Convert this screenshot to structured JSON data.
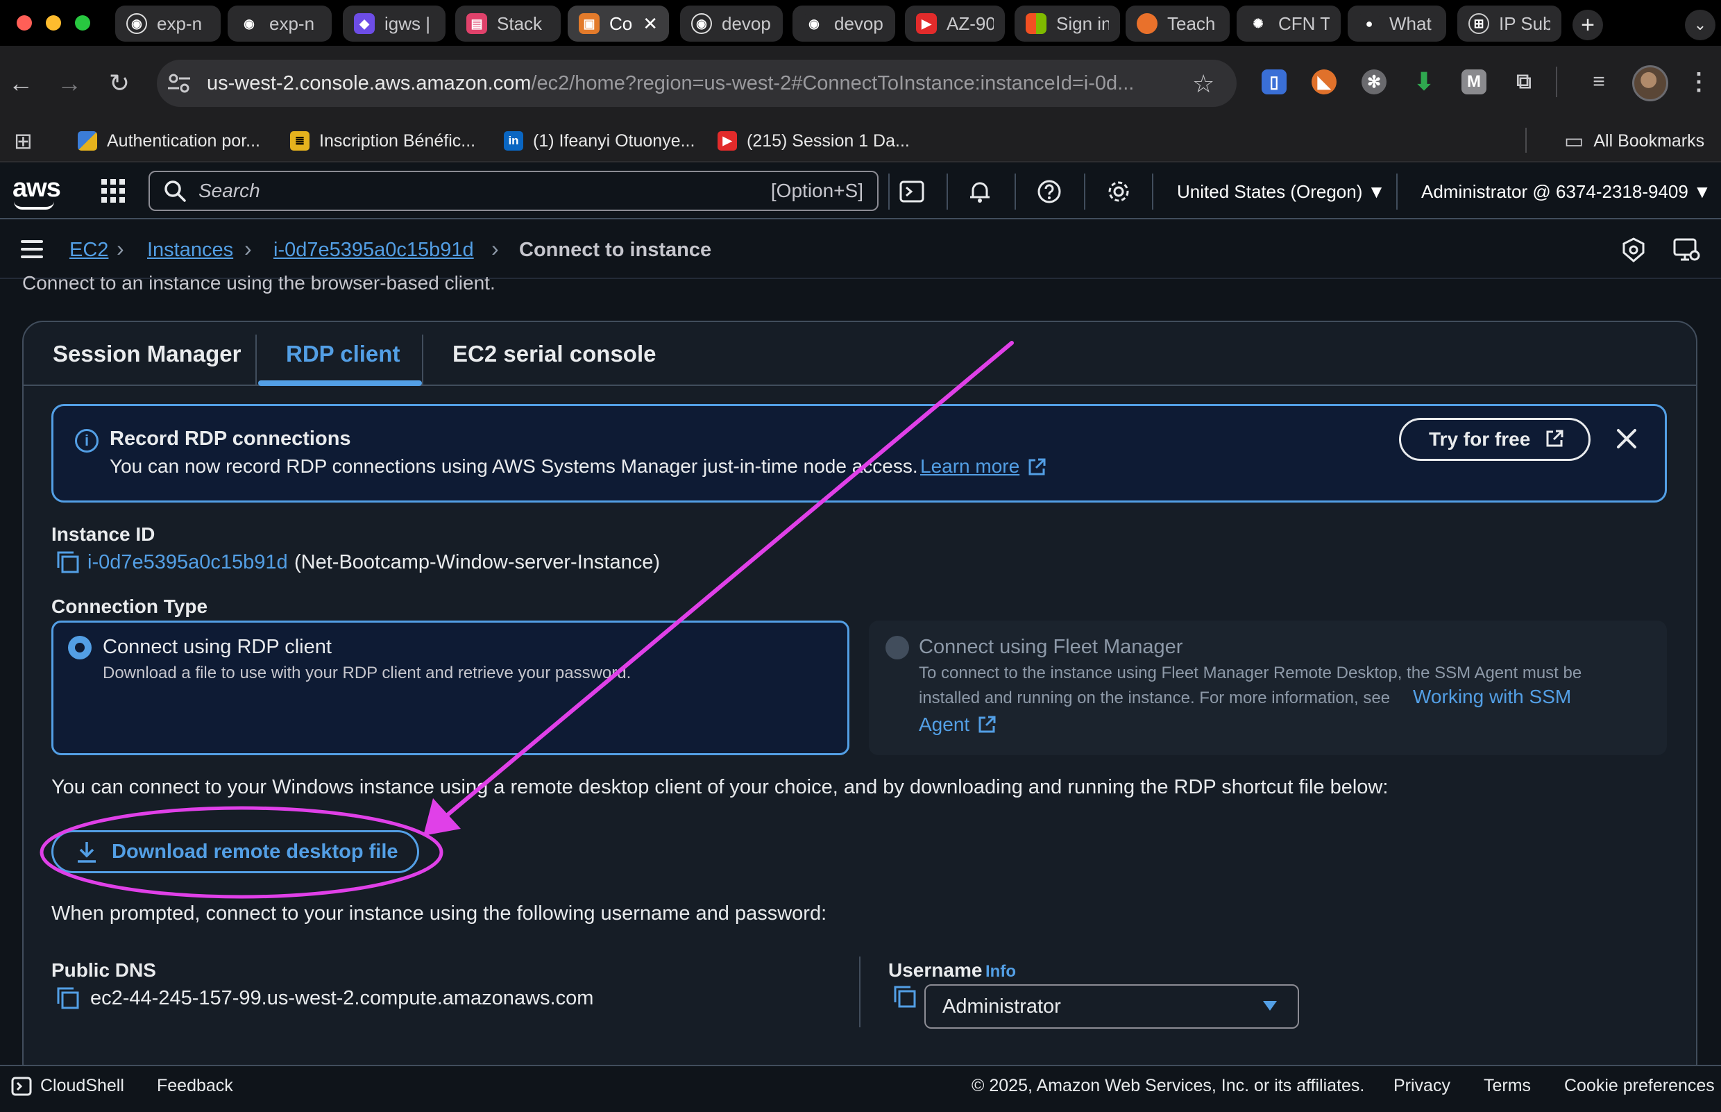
{
  "browser": {
    "tabs": [
      {
        "label": "exp-n",
        "icon": "github-icon",
        "color": "#2a2a2c"
      },
      {
        "label": "exp-n",
        "icon": "github-icon",
        "color": "#2a2a2c"
      },
      {
        "label": "igws |",
        "icon": "igws-icon",
        "color": "#6d4de6"
      },
      {
        "label": "Stack",
        "icon": "stack-icon",
        "color": "#e0426b"
      },
      {
        "label": "Co",
        "icon": "aws-console-icon",
        "color": "#e37b2b"
      },
      {
        "label": "devop",
        "icon": "github-icon",
        "color": "#2a2a2c"
      },
      {
        "label": "devop",
        "icon": "github-icon",
        "color": "#2a2a2c"
      },
      {
        "label": "AZ-90",
        "icon": "youtube-icon",
        "color": "#e22b2b"
      },
      {
        "label": "Sign in",
        "icon": "microsoft-icon",
        "color": "#2a2a2c"
      },
      {
        "label": "Teach",
        "icon": "teach-icon",
        "color": "#e9712b"
      },
      {
        "label": "CFN T",
        "icon": "openai-icon",
        "color": "#2a2a2c"
      },
      {
        "label": "What",
        "icon": "globe-icon",
        "color": "#2a2a2c"
      },
      {
        "label": "IP Sub",
        "icon": "ipsub-icon",
        "color": "#2a2a2c"
      }
    ],
    "url_host": "us-west-2.console.aws.amazon.com",
    "url_path": "/ec2/home?region=us-west-2#ConnectToInstance:instanceId=i-0d...",
    "bookmarks": [
      {
        "label": "Authentication por...",
        "icon": "flag-icon"
      },
      {
        "label": "Inscription Bénéfic...",
        "icon": "form-icon"
      },
      {
        "label": "(1) Ifeanyi Otuonye...",
        "icon": "linkedin-icon"
      },
      {
        "label": "(215) Session 1 Da...",
        "icon": "youtube-icon"
      }
    ],
    "all_bookmarks": "All Bookmarks"
  },
  "aws_header": {
    "logo": "aws",
    "search_placeholder": "Search",
    "search_shortcut": "[Option+S]",
    "region": "United States (Oregon) ▼",
    "account": "Administrator @ 6374-2318-9409 ▼"
  },
  "breadcrumb": {
    "items": [
      "EC2",
      "Instances",
      "i-0d7e5395a0c15b91d"
    ],
    "current": "Connect to instance"
  },
  "page": {
    "intro": "Connect to an instance using the browser-based client.",
    "tabs": [
      "Session Manager",
      "RDP client",
      "EC2 serial console"
    ],
    "active_tab": "RDP client",
    "flash": {
      "title": "Record RDP connections",
      "body": "You can now record RDP connections using AWS Systems Manager just-in-time node access.",
      "link": "Learn more",
      "button": "Try for free"
    },
    "instance_id_label": "Instance ID",
    "instance_id": "i-0d7e5395a0c15b91d",
    "instance_name": "(Net-Bootcamp-Window-server-Instance)",
    "connection_type_label": "Connection Type",
    "option_rdp": {
      "title": "Connect using RDP client",
      "desc": "Download a file to use with your RDP client and retrieve your password."
    },
    "option_fleet": {
      "title": "Connect using Fleet Manager",
      "desc_line1": "To connect to the instance using Fleet Manager Remote Desktop, the SSM Agent must be",
      "desc_line2": "installed and running on the instance. For more information, see",
      "link_part1": "Working with SSM",
      "link_part2": "Agent"
    },
    "rdp_paragraph": "You can connect to your Windows instance using a remote desktop client of your choice, and by downloading and running the RDP shortcut file below:",
    "download_button": "Download remote desktop file",
    "prompt_paragraph": "When prompted, connect to your instance using the following username and password:",
    "public_dns_label": "Public DNS",
    "public_dns": "ec2-44-245-157-99.us-west-2.compute.amazonaws.com",
    "username_label": "Username",
    "username_info": "Info",
    "username_value": "Administrator"
  },
  "footer": {
    "cloudshell": "CloudShell",
    "feedback": "Feedback",
    "copyright": "© 2025, Amazon Web Services, Inc. or its affiliates.",
    "privacy": "Privacy",
    "terms": "Terms",
    "cookies": "Cookie preferences"
  },
  "colors": {
    "accent": "#539fe5",
    "annotation": "#e040e8",
    "background": "#0f141a"
  }
}
